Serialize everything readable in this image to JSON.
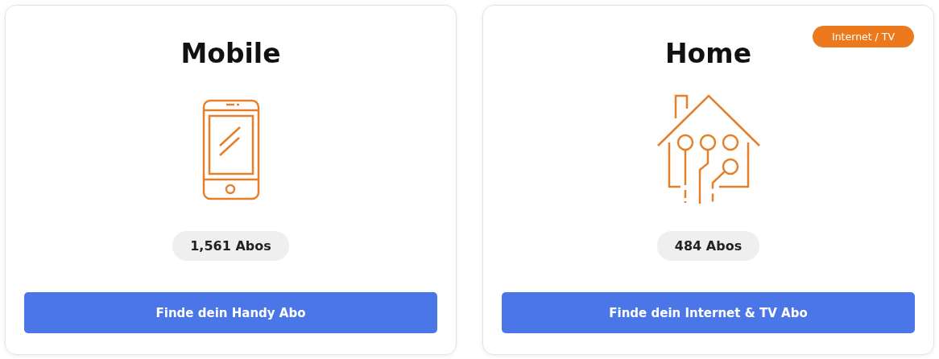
{
  "cards": [
    {
      "kind": "mobile",
      "title": "Mobile",
      "count": "1,561 Abos",
      "button": "Finde dein Handy Abo"
    },
    {
      "kind": "home",
      "title": "Home",
      "badge": "Internet / TV",
      "count": "484 Abos",
      "button": "Finde dein Internet & TV Abo"
    }
  ]
}
